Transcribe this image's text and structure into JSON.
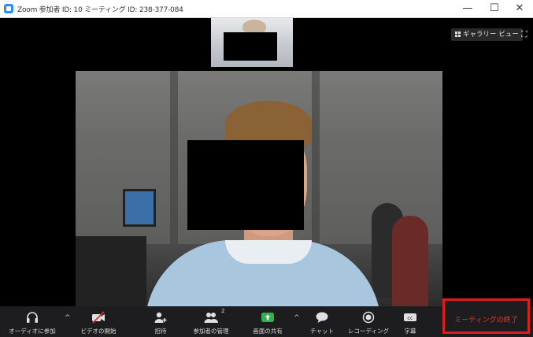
{
  "window": {
    "title": "Zoom 参加者 ID: 10 ミーティング ID: 238-377-084",
    "minimize_glyph": "—",
    "maximize_glyph": "☐",
    "close_glyph": "✕"
  },
  "view_controls": {
    "gallery_label": "ギャラリー ビュー",
    "fullscreen_glyph": "⛶"
  },
  "toolbar": {
    "audio_label": "オーディオに参加",
    "video_label": "ビデオの開始",
    "invite_label": "招待",
    "participants_label": "参加者の管理",
    "participants_count": "2",
    "share_label": "画面の共有",
    "chat_label": "チャット",
    "record_label": "レコーディング",
    "cc_label": "字幕",
    "caret_glyph": "^",
    "end_label": "ミーティングの終了"
  },
  "colors": {
    "accent": "#2d8cff",
    "share_green": "#2fb24c",
    "end_red": "#e01d1d",
    "toolbar_bg": "#1d1d1f"
  },
  "icons": {
    "audio": "headphones-icon",
    "video": "video-off-icon",
    "invite": "invite-person-icon",
    "participants": "participants-icon",
    "share": "share-screen-icon",
    "chat": "chat-bubble-icon",
    "record": "record-icon",
    "cc": "closed-caption-icon"
  }
}
